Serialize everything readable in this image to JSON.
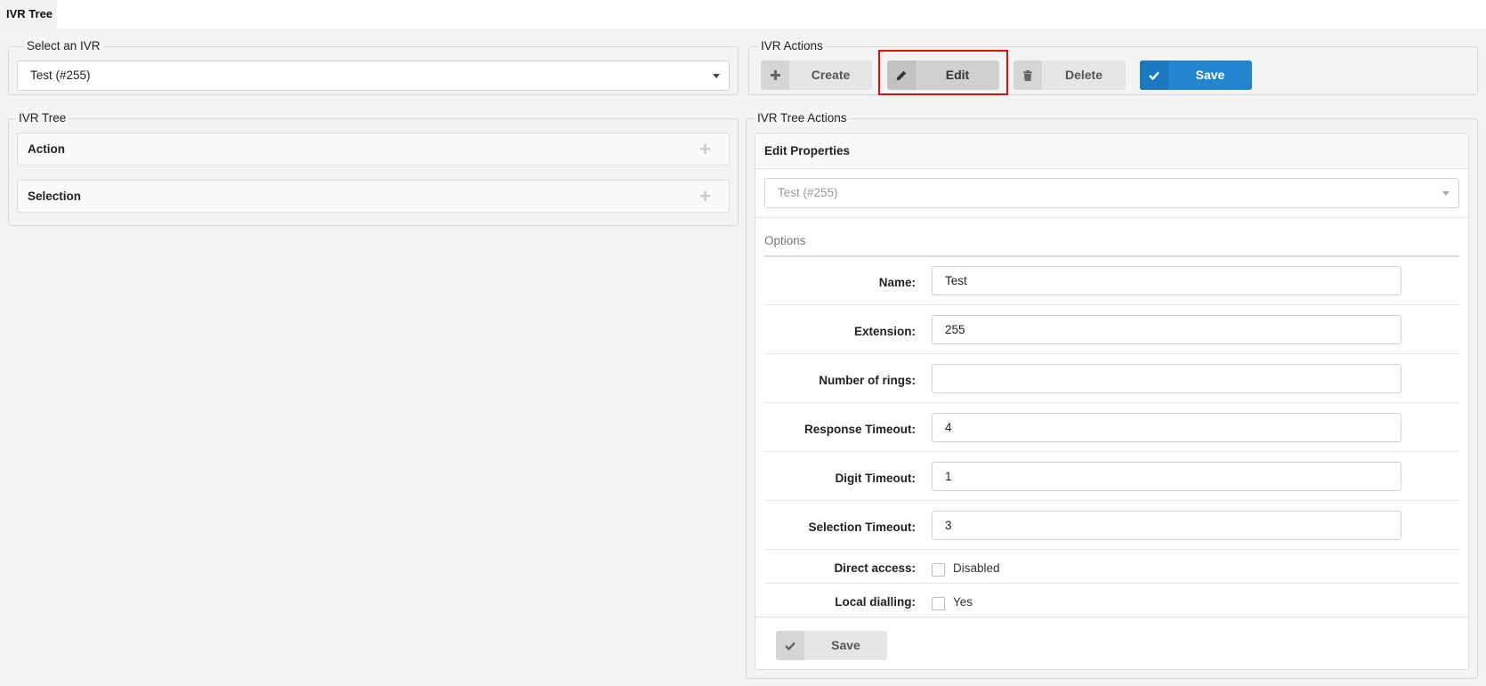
{
  "tab": {
    "label": "IVR Tree"
  },
  "select_ivr": {
    "legend": "Select an IVR",
    "value": "Test (#255)"
  },
  "ivr_actions": {
    "legend": "IVR Actions",
    "create": "Create",
    "edit": "Edit",
    "delete": "Delete",
    "save": "Save"
  },
  "ivr_tree": {
    "legend": "IVR Tree",
    "items": [
      {
        "label": "Action"
      },
      {
        "label": "Selection"
      }
    ]
  },
  "tree_actions": {
    "legend": "IVR Tree Actions",
    "panel_title": "Edit Properties",
    "selected": "Test (#255)",
    "options_title": "Options",
    "fields": {
      "name": {
        "label": "Name:",
        "value": "Test"
      },
      "extension": {
        "label": "Extension:",
        "value": "255"
      },
      "rings": {
        "label": "Number of rings:",
        "value": ""
      },
      "response_timeout": {
        "label": "Response Timeout:",
        "value": "4"
      },
      "digit_timeout": {
        "label": "Digit Timeout:",
        "value": "1"
      },
      "selection_timeout": {
        "label": "Selection Timeout:",
        "value": "3"
      }
    },
    "direct_access": {
      "label": "Direct access:",
      "checkbox_label": "Disabled",
      "checked": false
    },
    "local_dialling": {
      "label": "Local dialling:",
      "checkbox_label": "Yes",
      "checked": false
    },
    "save": "Save"
  },
  "colors": {
    "primary": "#2185d0",
    "highlight": "#e01010"
  }
}
